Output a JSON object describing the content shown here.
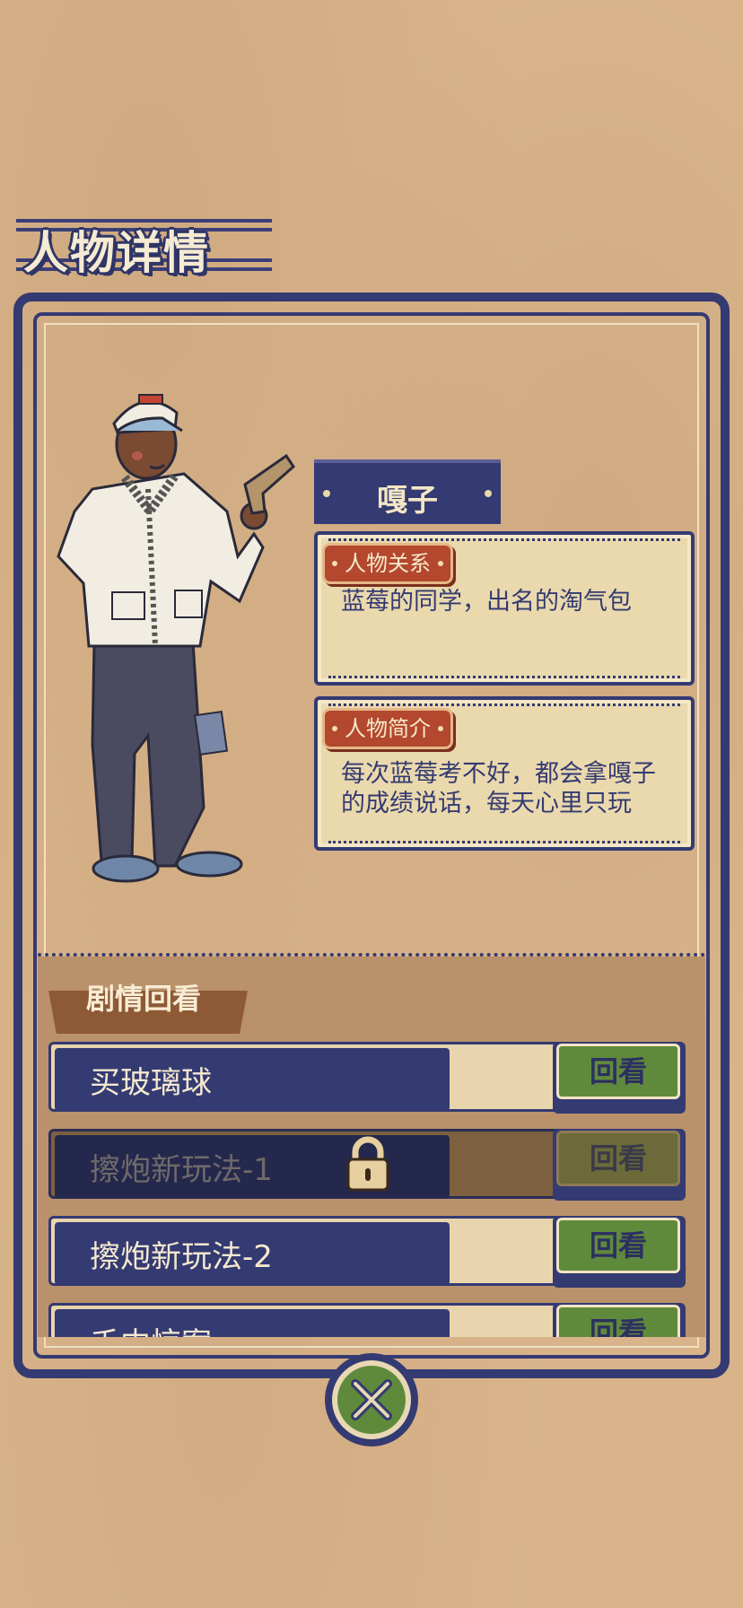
{
  "page_title": "人物详情",
  "character": {
    "name": "嘎子",
    "relation_tag": "人物关系",
    "relation_text": "蓝莓的同学，出名的淘气包",
    "intro_tag": "人物简介",
    "intro_text": "每次蓝莓考不好，都会拿嘎子的成绩说话，每天心里只玩"
  },
  "review": {
    "title": "剧情回看",
    "items": [
      {
        "label": "买玻璃球",
        "button": "回看",
        "locked": false
      },
      {
        "label": "擦炮新玩法-1",
        "button": "回看",
        "locked": true
      },
      {
        "label": "擦炮新玩法-2",
        "button": "回看",
        "locked": false
      },
      {
        "label": "千中惊案",
        "button": "回看",
        "locked": false
      }
    ]
  },
  "colors": {
    "navy": "#343a72",
    "parchment": "#d9b48a",
    "green": "#5f8a3c",
    "tag_red": "#b3482e"
  },
  "icons": {
    "close": "close-x-icon",
    "lock": "lock-icon"
  }
}
